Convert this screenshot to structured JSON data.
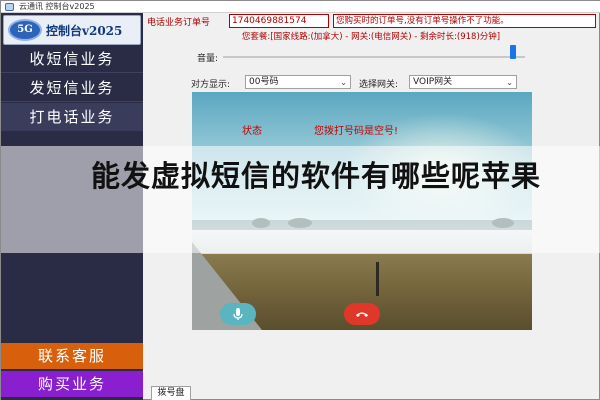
{
  "window": {
    "title": "云通讯 控制台v2025"
  },
  "sidebar": {
    "logo_badge": "5G",
    "logo_text": "控制台v2025",
    "items": [
      {
        "label": "收短信业务"
      },
      {
        "label": "发短信业务"
      },
      {
        "label": "打电话业务"
      }
    ],
    "contact_label": "联系客服",
    "buy_label": "购买业务"
  },
  "order": {
    "label": "电话业务订单号",
    "value": "1740469881574",
    "hint": "您购买时的订单号,没有订单号操作不了功能。"
  },
  "package": {
    "text": "您套餐:[国家线路:(加拿大) - 网关:(电信网关) - 剩余时长:(918)分钟]"
  },
  "controls": {
    "volume_label": "音量:",
    "volume_level": 0.97,
    "display_label": "对方显示:",
    "display_value": "00号码",
    "gateway_label": "选择网关:",
    "gateway_value": "VOIP网关"
  },
  "call": {
    "status_label": "状态",
    "status_message": "您拨打号码是空号!"
  },
  "tabs": {
    "dialpad": "拨号盘"
  },
  "overlay": {
    "text": "能发虚拟短信的软件有哪些呢苹果"
  },
  "colors": {
    "sidebar_bg": "#2a2b45",
    "accent_red": "#b00000",
    "contact_orange": "#d8600c",
    "buy_purple": "#8a1fd0",
    "hangup_red": "#e0372b",
    "mic_teal": "#5ab5c0"
  },
  "icons": {
    "mic": "microphone-icon",
    "hangup": "phone-hangup-icon",
    "chevron": "chevron-down-icon"
  }
}
